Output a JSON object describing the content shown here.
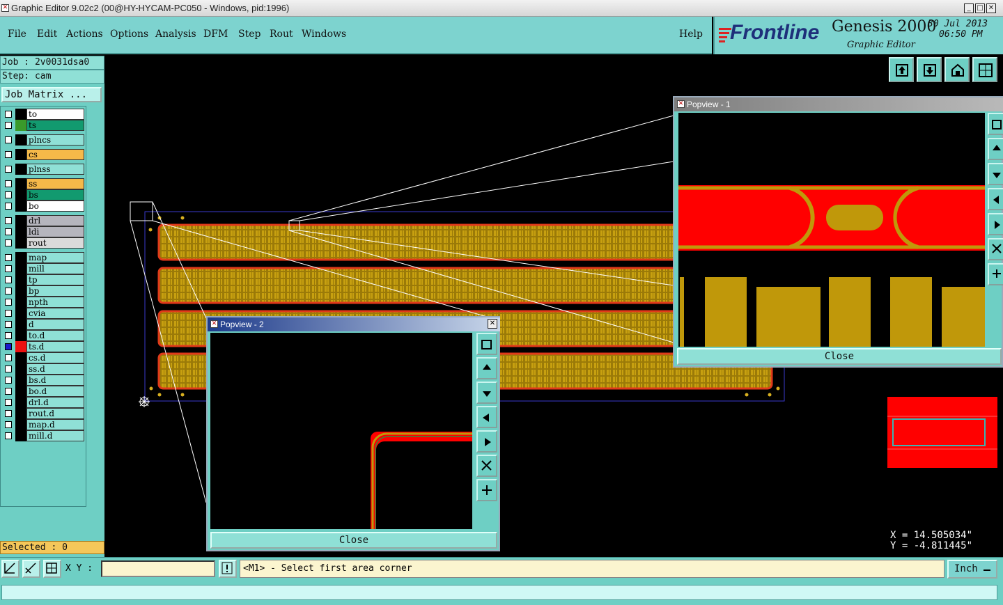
{
  "window": {
    "title": "Graphic Editor 9.02c2 (00@HY-HYCAM-PC050 - Windows, pid:1996)",
    "min": "_",
    "max": "□",
    "close": "✕"
  },
  "menu": [
    "File",
    "Edit",
    "Actions",
    "Options",
    "Analysis",
    "DFM",
    "Step",
    "Rout",
    "Windows"
  ],
  "help": "Help",
  "brand": {
    "logo": "Frontline",
    "product": "Genesis 2000",
    "subtitle": "Graphic Editor",
    "date": "30 Jul 2013",
    "time": "06:50 PM"
  },
  "job": {
    "job_line": "Job : 2v0031dsa0",
    "step_line": "Step: cam",
    "matrix_button": "Job Matrix ..."
  },
  "layers": [
    {
      "name": "to",
      "color": "#ffffff",
      "swatch": "#000000"
    },
    {
      "name": "ts",
      "color": "#129a6f",
      "swatch": "#3a9a2a"
    },
    {
      "name": "plncs",
      "color": "#8fe0d6",
      "swatch": "#000000"
    },
    {
      "name": "cs",
      "color": "#f5b949",
      "swatch": "#000000"
    },
    {
      "name": "plnss",
      "color": "#8fe0d6",
      "swatch": "#000000"
    },
    {
      "name": "ss",
      "color": "#f5b949",
      "swatch": "#000000"
    },
    {
      "name": "bs",
      "color": "#129a6f",
      "swatch": "#000000"
    },
    {
      "name": "bo",
      "color": "#ffffff",
      "swatch": "#000000"
    },
    {
      "name": "drl",
      "color": "#b5b5bd",
      "swatch": "#000000"
    },
    {
      "name": "ldi",
      "color": "#b5b5bd",
      "swatch": "#000000"
    },
    {
      "name": "rout",
      "color": "#dadada",
      "swatch": "#000000"
    },
    {
      "name": "map",
      "color": "#8fe0d6",
      "swatch": "#000000"
    },
    {
      "name": "mill",
      "color": "#8fe0d6",
      "swatch": "#000000"
    },
    {
      "name": "tp",
      "color": "#8fe0d6",
      "swatch": "#000000"
    },
    {
      "name": "bp",
      "color": "#8fe0d6",
      "swatch": "#000000"
    },
    {
      "name": "npth",
      "color": "#8fe0d6",
      "swatch": "#000000"
    },
    {
      "name": "cvia",
      "color": "#8fe0d6",
      "swatch": "#000000"
    },
    {
      "name": "d",
      "color": "#8fe0d6",
      "swatch": "#000000"
    },
    {
      "name": "to.d",
      "color": "#8fe0d6",
      "swatch": "#000000"
    },
    {
      "name": "ts.d",
      "color": "#8fe0d6",
      "swatch": "#ee1111",
      "active": true
    },
    {
      "name": "cs.d",
      "color": "#8fe0d6",
      "swatch": "#000000"
    },
    {
      "name": "ss.d",
      "color": "#8fe0d6",
      "swatch": "#000000"
    },
    {
      "name": "bs.d",
      "color": "#8fe0d6",
      "swatch": "#000000"
    },
    {
      "name": "bo.d",
      "color": "#8fe0d6",
      "swatch": "#000000"
    },
    {
      "name": "drl.d",
      "color": "#8fe0d6",
      "swatch": "#000000"
    },
    {
      "name": "rout.d",
      "color": "#8fe0d6",
      "swatch": "#000000"
    },
    {
      "name": "map.d",
      "color": "#8fe0d6",
      "swatch": "#000000"
    },
    {
      "name": "mill.d",
      "color": "#8fe0d6",
      "swatch": "#000000"
    }
  ],
  "selected": "Selected : 0",
  "popview1": {
    "title": "Popview - 1",
    "close_label": "Close"
  },
  "popview2": {
    "title": "Popview - 2",
    "close_label": "Close"
  },
  "coords": {
    "x": "X = 14.505034\"",
    "y": "Y = -4.811445\""
  },
  "status": {
    "xy_label": "X Y :",
    "xy_value": "",
    "message": "<M1> - Select first area corner",
    "unit": "Inch"
  },
  "colors": {
    "panel": "#6ecfc4",
    "copper": "#c0980a",
    "board_outline": "#e03a1a",
    "highlight": "#ff0000"
  }
}
